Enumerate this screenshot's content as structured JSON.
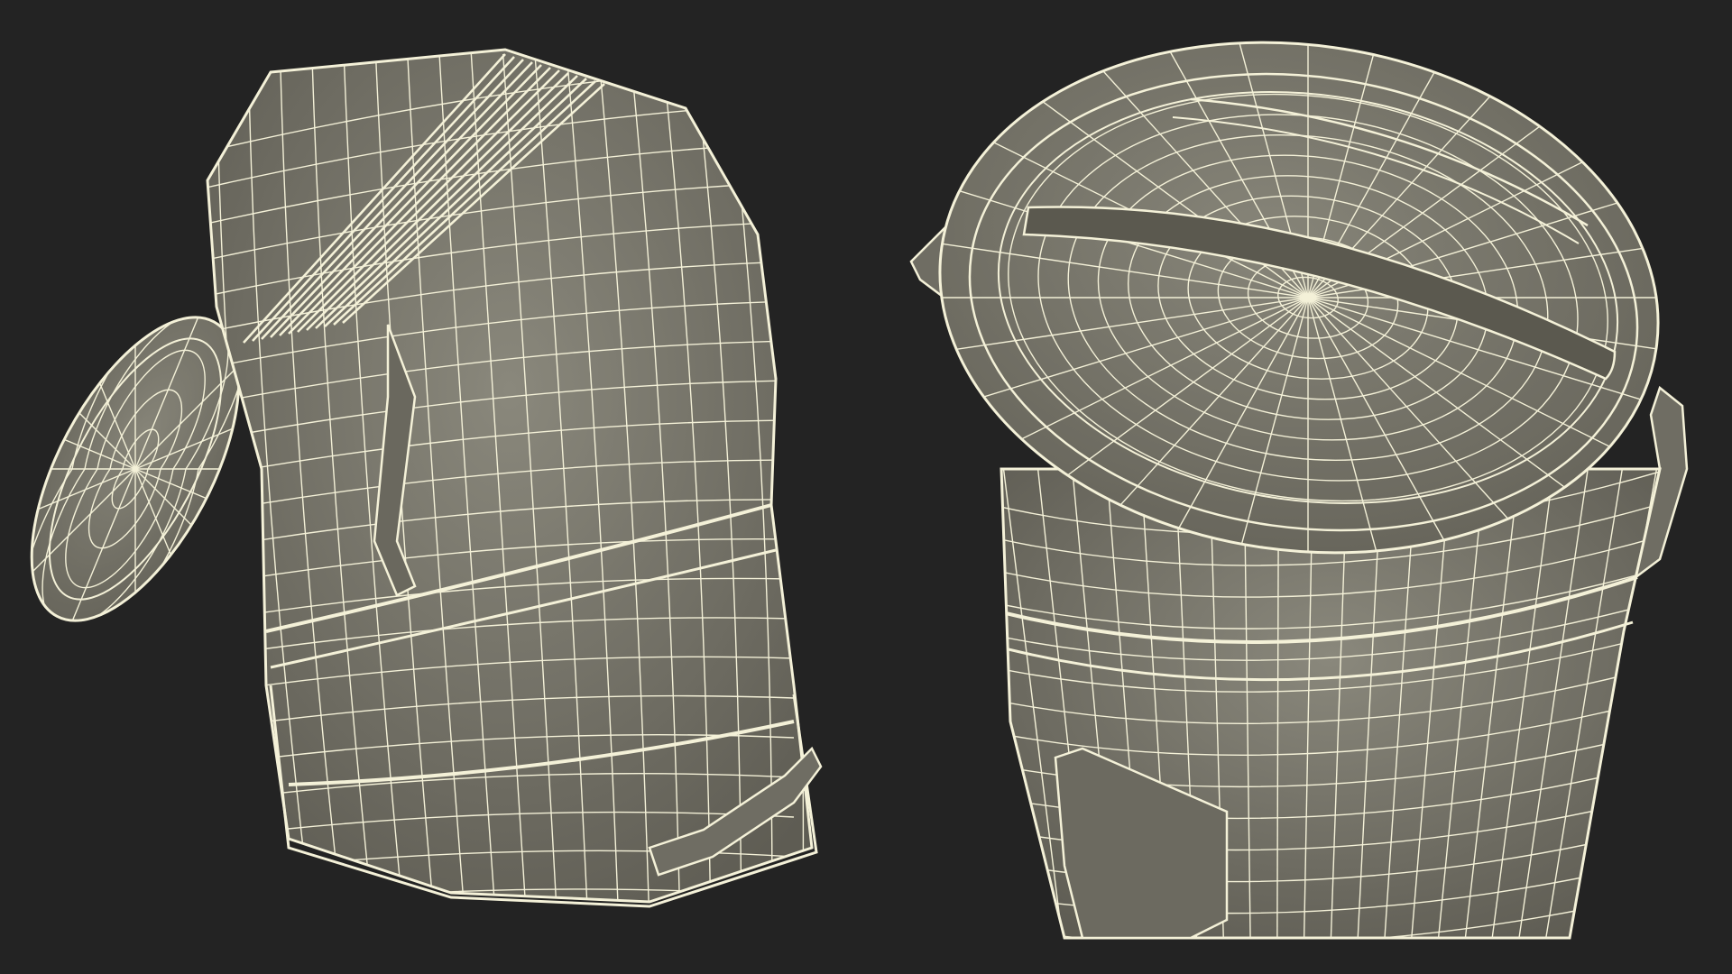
{
  "scene": {
    "background_color": "#232323",
    "surface_color": "#7d7b70",
    "surface_shade_color": "#5f5d54",
    "wire_color": "#f4f1d8",
    "objects": [
      {
        "name": "trash-can-tilted-with-open-lid",
        "parts": [
          "lid-open",
          "body",
          "base-rim",
          "handle-bottom",
          "pedal-hinge"
        ]
      },
      {
        "name": "trash-can-upright-closed",
        "parts": [
          "lid-closed",
          "lid-groove",
          "body",
          "rim-band",
          "handle-left",
          "handle-right",
          "pedal"
        ]
      }
    ]
  }
}
